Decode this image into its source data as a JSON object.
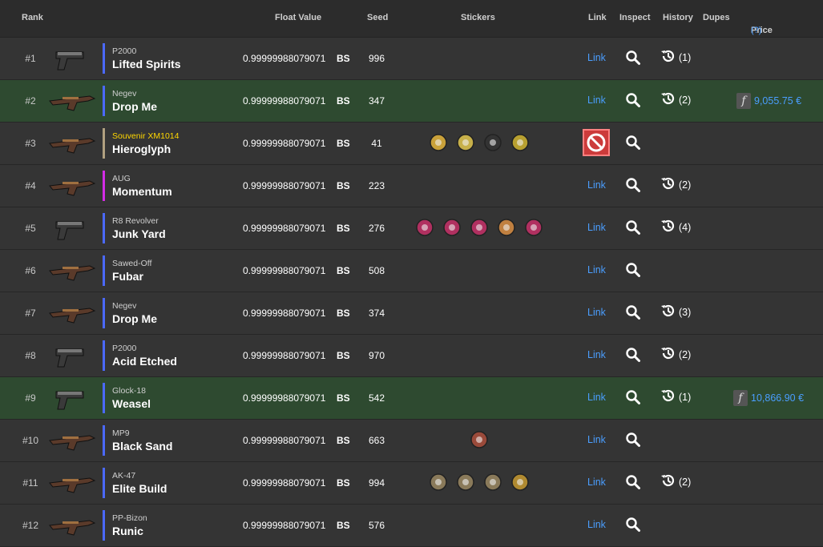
{
  "columns": {
    "rank": "Rank",
    "float": "Float Value",
    "seed": "Seed",
    "stickers": "Stickers",
    "link": "Link",
    "inspect": "Inspect",
    "history": "History",
    "dupes": "Dupes",
    "price": "Price",
    "price_help": "(?)"
  },
  "link_label": "Link",
  "rows": [
    {
      "rank": "#1",
      "weapon": "P2000",
      "skin": "Lifted Spirits",
      "float": "0.99999988079071",
      "wear": "BS",
      "seed": "996",
      "history": "(1)",
      "price": ""
    },
    {
      "rank": "#2",
      "weapon": "Negev",
      "skin": "Drop Me",
      "float": "0.99999988079071",
      "wear": "BS",
      "seed": "347",
      "history": "(2)",
      "price": "9,055.75 €"
    },
    {
      "rank": "#3",
      "weapon": "Souvenir XM1014",
      "skin": "Hieroglyph",
      "float": "0.99999988079071",
      "wear": "BS",
      "seed": "41",
      "history": "",
      "price": ""
    },
    {
      "rank": "#4",
      "weapon": "AUG",
      "skin": "Momentum",
      "float": "0.99999988079071",
      "wear": "BS",
      "seed": "223",
      "history": "(2)",
      "price": ""
    },
    {
      "rank": "#5",
      "weapon": "R8 Revolver",
      "skin": "Junk Yard",
      "float": "0.99999988079071",
      "wear": "BS",
      "seed": "276",
      "history": "(4)",
      "price": ""
    },
    {
      "rank": "#6",
      "weapon": "Sawed-Off",
      "skin": "Fubar",
      "float": "0.99999988079071",
      "wear": "BS",
      "seed": "508",
      "history": "",
      "price": ""
    },
    {
      "rank": "#7",
      "weapon": "Negev",
      "skin": "Drop Me",
      "float": "0.99999988079071",
      "wear": "BS",
      "seed": "374",
      "history": "(3)",
      "price": ""
    },
    {
      "rank": "#8",
      "weapon": "P2000",
      "skin": "Acid Etched",
      "float": "0.99999988079071",
      "wear": "BS",
      "seed": "970",
      "history": "(2)",
      "price": ""
    },
    {
      "rank": "#9",
      "weapon": "Glock-18",
      "skin": "Weasel",
      "float": "0.99999988079071",
      "wear": "BS",
      "seed": "542",
      "history": "(1)",
      "price": "10,866.90 €"
    },
    {
      "rank": "#10",
      "weapon": "MP9",
      "skin": "Black Sand",
      "float": "0.99999988079071",
      "wear": "BS",
      "seed": "663",
      "history": "",
      "price": ""
    },
    {
      "rank": "#11",
      "weapon": "AK-47",
      "skin": "Elite Build",
      "float": "0.99999988079071",
      "wear": "BS",
      "seed": "994",
      "history": "(2)",
      "price": ""
    },
    {
      "rank": "#12",
      "weapon": "PP-Bizon",
      "skin": "Runic",
      "float": "0.99999988079071",
      "wear": "BS",
      "seed": "576",
      "history": "",
      "price": ""
    }
  ],
  "colors": {
    "link": "#4a9eff",
    "row_bg": "#343434",
    "priced_row_bg": "#2e4a30",
    "rarity_milspec": "#4b69ff",
    "rarity_restricted": "#d32ce6",
    "souvenir": "#ffd700"
  }
}
